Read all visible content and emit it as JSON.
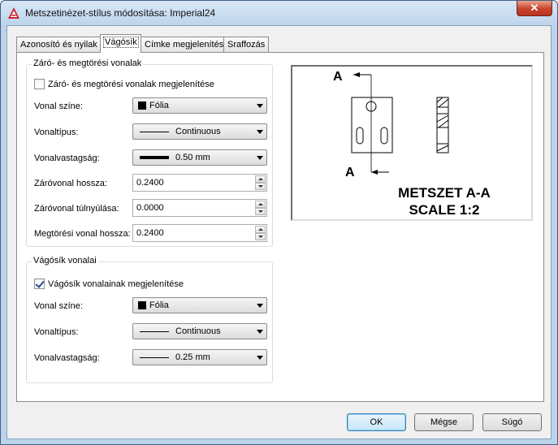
{
  "window": {
    "title": "Metszetinézet-stílus módosítása: Imperial24",
    "close_symbol": "✕"
  },
  "tabs": [
    {
      "label": "Azonosító és nyilak",
      "active": false
    },
    {
      "label": "Vágósík",
      "active": true
    },
    {
      "label": "Címke megjelenítése",
      "active": false
    },
    {
      "label": "Sraffozás",
      "active": false
    }
  ],
  "cutting_plane_group": {
    "title": "Záró- és megtörési vonalak",
    "show_checkbox_label": "Záró- és megtörési vonalak megjelenítése",
    "show_checked": false,
    "line_color": {
      "label": "Vonal színe:",
      "value": "Fólia"
    },
    "linetype": {
      "label": "Vonaltípus:",
      "value": "Continuous"
    },
    "lineweight": {
      "label": "Vonalvastagság:",
      "value": "0.50 mm"
    },
    "end_line_length": {
      "label": "Záróvonal hossza:",
      "value": "0.2400"
    },
    "end_line_overshoot": {
      "label": "Záróvonal túlnyúlása:",
      "value": "0.0000"
    },
    "bend_line_length": {
      "label": "Megtörési vonal hossza:",
      "value": "0.2400"
    }
  },
  "plane_lines_group": {
    "title": "Vágósík vonalai",
    "show_checkbox_label": "Vágósík vonalainak megjelenítése",
    "show_checked": true,
    "line_color": {
      "label": "Vonal színe:",
      "value": "Fólia"
    },
    "linetype": {
      "label": "Vonaltípus:",
      "value": "Continuous"
    },
    "lineweight": {
      "label": "Vonalvastagság:",
      "value": "0.25 mm"
    }
  },
  "preview": {
    "label_top": "A",
    "label_bottom": "A",
    "caption_line1": "METSZET A-A",
    "caption_line2": "SCALE 1:2"
  },
  "buttons": {
    "ok": "OK",
    "cancel": "Mégse",
    "help": "Súgó"
  },
  "colors": {
    "accent_close": "#c8432a",
    "swatch": "#000000"
  }
}
